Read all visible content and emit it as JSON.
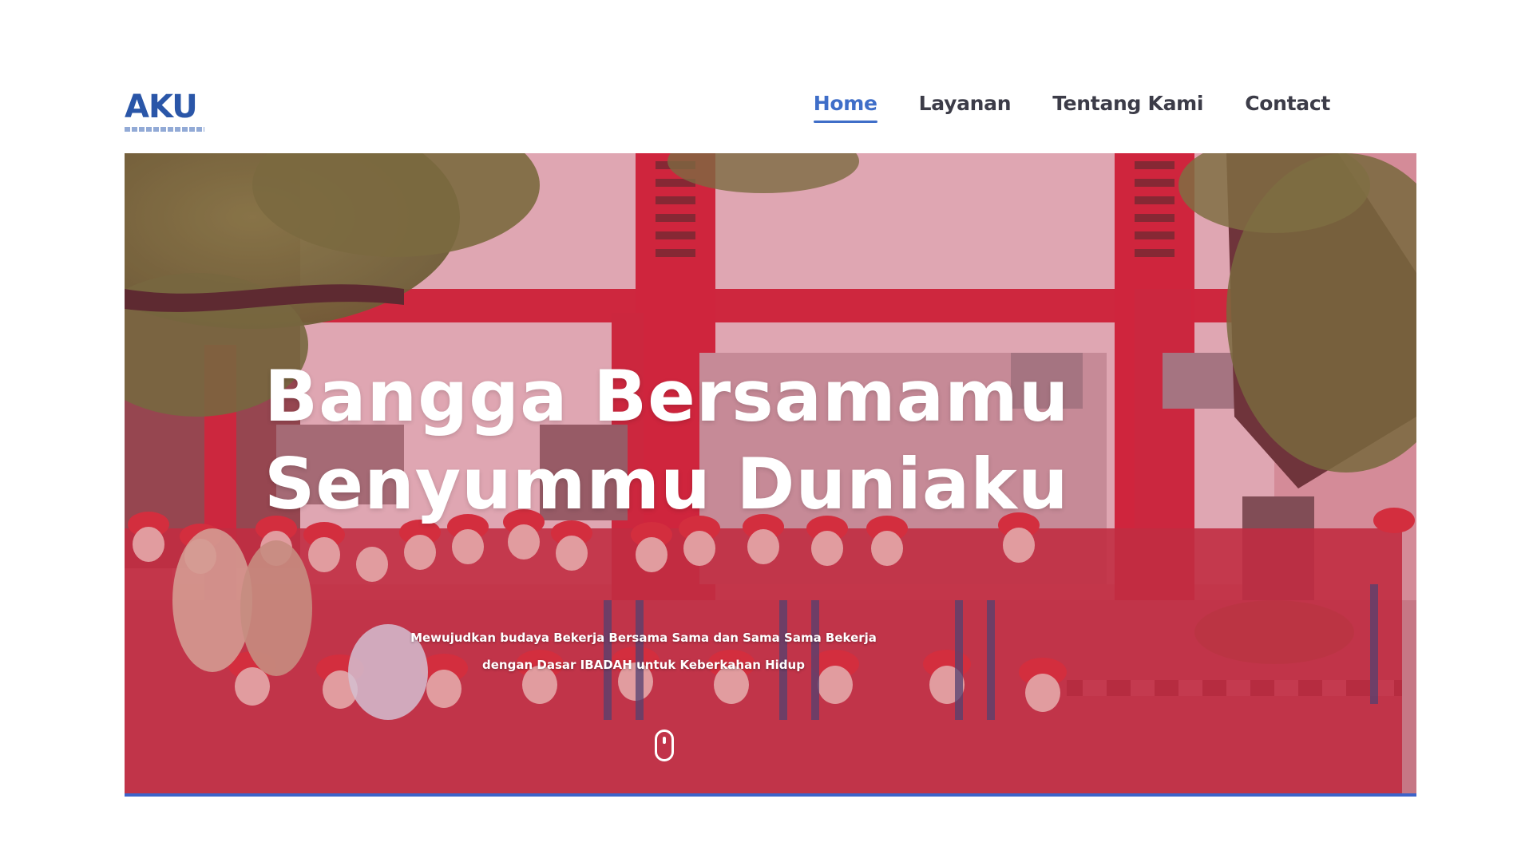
{
  "header": {
    "logo": "AKU",
    "nav": [
      {
        "label": "Home",
        "active": true
      },
      {
        "label": "Layanan",
        "active": false
      },
      {
        "label": "Tentang Kami",
        "active": false
      },
      {
        "label": "Contact",
        "active": false
      }
    ]
  },
  "hero": {
    "title_line1": "Bangga Bersamamu",
    "title_line2": "Senyummu Duniaku",
    "subtitle_line1": "Mewujudkan budaya Bekerja Bersama Sama dan Sama Sama Bekerja",
    "subtitle_line2": "dengan Dasar IBADAH untuk Keberkahan Hidup"
  },
  "colors": {
    "accent": "#3f6ec8",
    "nav_text": "#3c3c48",
    "logo": "#2a56a8",
    "hero_tint": "#be1e3c",
    "bottom_line": "#3d63c9"
  },
  "icons": {
    "scroll": "mouse-scroll-icon"
  }
}
